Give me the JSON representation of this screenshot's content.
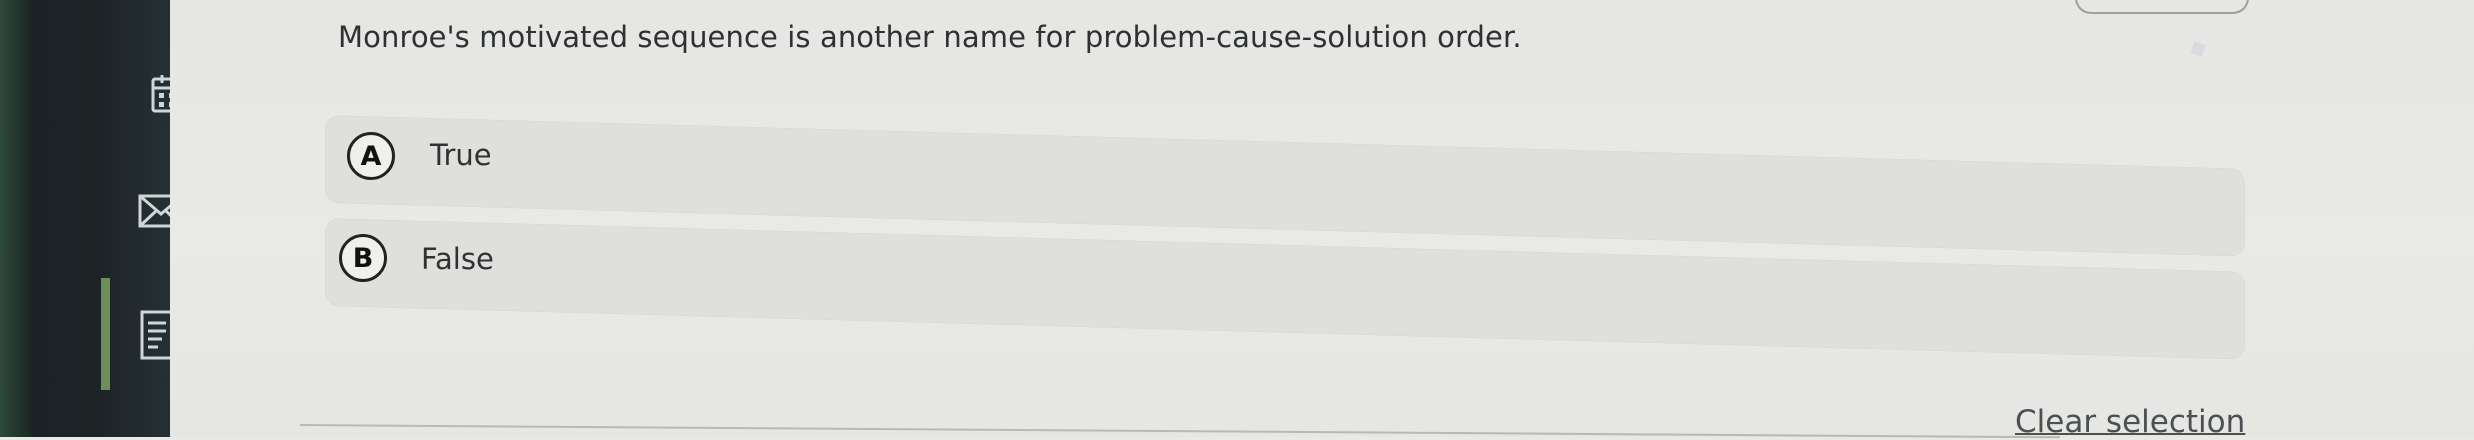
{
  "sidebar": {
    "icons": [
      {
        "name": "calendar-icon"
      },
      {
        "name": "mail-icon"
      },
      {
        "name": "notes-icon"
      }
    ],
    "active_index": 2
  },
  "question": {
    "text": "Monroe's motivated sequence is another name for problem-cause-solution order."
  },
  "options": [
    {
      "letter": "A",
      "label": "True"
    },
    {
      "letter": "B",
      "label": "False"
    }
  ],
  "actions": {
    "clear_selection_label": "Clear selection"
  },
  "colors": {
    "rail_dark": "#1d2427",
    "active_indicator": "#6a8f57",
    "content_bg": "#e9e9e6",
    "option_bg": "#dfdfdc",
    "text_primary": "#2e3134"
  }
}
